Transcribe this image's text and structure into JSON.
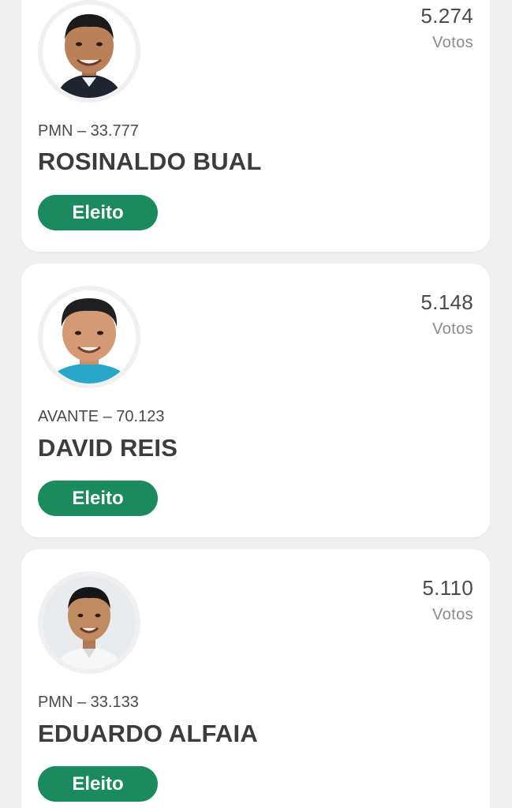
{
  "candidates": [
    {
      "votes": "5.274",
      "votes_label": "Votos",
      "party_number": "PMN – 33.777",
      "name": "ROSINALDO BUAL",
      "status": "Eleito"
    },
    {
      "votes": "5.148",
      "votes_label": "Votos",
      "party_number": "AVANTE – 70.123",
      "name": "DAVID REIS",
      "status": "Eleito"
    },
    {
      "votes": "5.110",
      "votes_label": "Votos",
      "party_number": "PMN – 33.133",
      "name": "EDUARDO ALFAIA",
      "status": "Eleito"
    }
  ],
  "colors": {
    "badge_green": "#1b8a5f",
    "background": "#f0f0f0",
    "card": "#ffffff"
  }
}
